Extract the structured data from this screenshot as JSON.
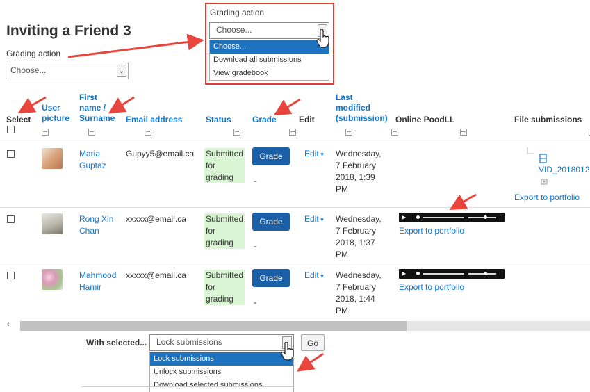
{
  "page": {
    "title": "Inviting a Friend 3"
  },
  "grading_action": {
    "label": "Grading action",
    "value": "Choose..."
  },
  "grading_popup": {
    "label": "Grading action",
    "value": "Choose...",
    "options": [
      "Choose...",
      "Download all submissions",
      "View gradebook"
    ]
  },
  "columns": {
    "select": "Select",
    "user_picture": [
      "User",
      "picture"
    ],
    "name": [
      "First",
      "name /",
      "Surname"
    ],
    "email": "Email address",
    "status": "Status",
    "grade": "Grade",
    "edit": "Edit",
    "last_modified": [
      "Last",
      "modified",
      "(submission)"
    ],
    "online_poodll": "Online PoodLL",
    "file_submissions": "File submissions"
  },
  "rows": [
    {
      "name": [
        "Maria",
        "Guptaz"
      ],
      "email": "Gupyy5@email.ca",
      "status": [
        "Submitted",
        "for",
        "grading"
      ],
      "grade_button": "Grade",
      "grade_value": "-",
      "edit": "Edit",
      "modified": [
        "Wednesday,",
        "7 February",
        "2018, 1:39",
        "PM"
      ],
      "file_name": "VID_2018012",
      "file_export": "Export to portfolio"
    },
    {
      "name": [
        "Rong Xin",
        "Chan"
      ],
      "email": "xxxxx@email.ca",
      "status": [
        "Submitted",
        "for",
        "grading"
      ],
      "grade_button": "Grade",
      "grade_value": "-",
      "edit": "Edit",
      "modified": [
        "Wednesday,",
        "7 February",
        "2018, 1:37",
        "PM"
      ],
      "poodll_export": "Export to portfolio"
    },
    {
      "name": [
        "Mahmood",
        "Hamir"
      ],
      "email": "xxxxx@email.ca",
      "status": [
        "Submitted",
        "for",
        "grading"
      ],
      "grade_button": "Grade",
      "grade_value": "-",
      "edit": "Edit",
      "modified": [
        "Wednesday,",
        "7 February",
        "2018, 1:44",
        "PM"
      ],
      "poodll_export": "Export to portfolio"
    }
  ],
  "bulk": {
    "label": "With selected...",
    "value": "Lock submissions",
    "go": "Go",
    "options": [
      "Lock submissions",
      "Unlock submissions",
      "Download selected submissions"
    ]
  },
  "colors": {
    "link": "#1177d1",
    "grade_button": "#1a5fa8",
    "status_bg": "#d9f5d3",
    "highlight": "#e03c31",
    "annotation_arrow": "#e8453c",
    "selected_option": "#1e73be"
  },
  "icons": {
    "collapse": "minus-box-icon",
    "dropdown": "chevron-down-icon",
    "cursor": "hand-pointer-icon",
    "file": "file-icon",
    "scroll_left": "chevron-left-icon"
  }
}
